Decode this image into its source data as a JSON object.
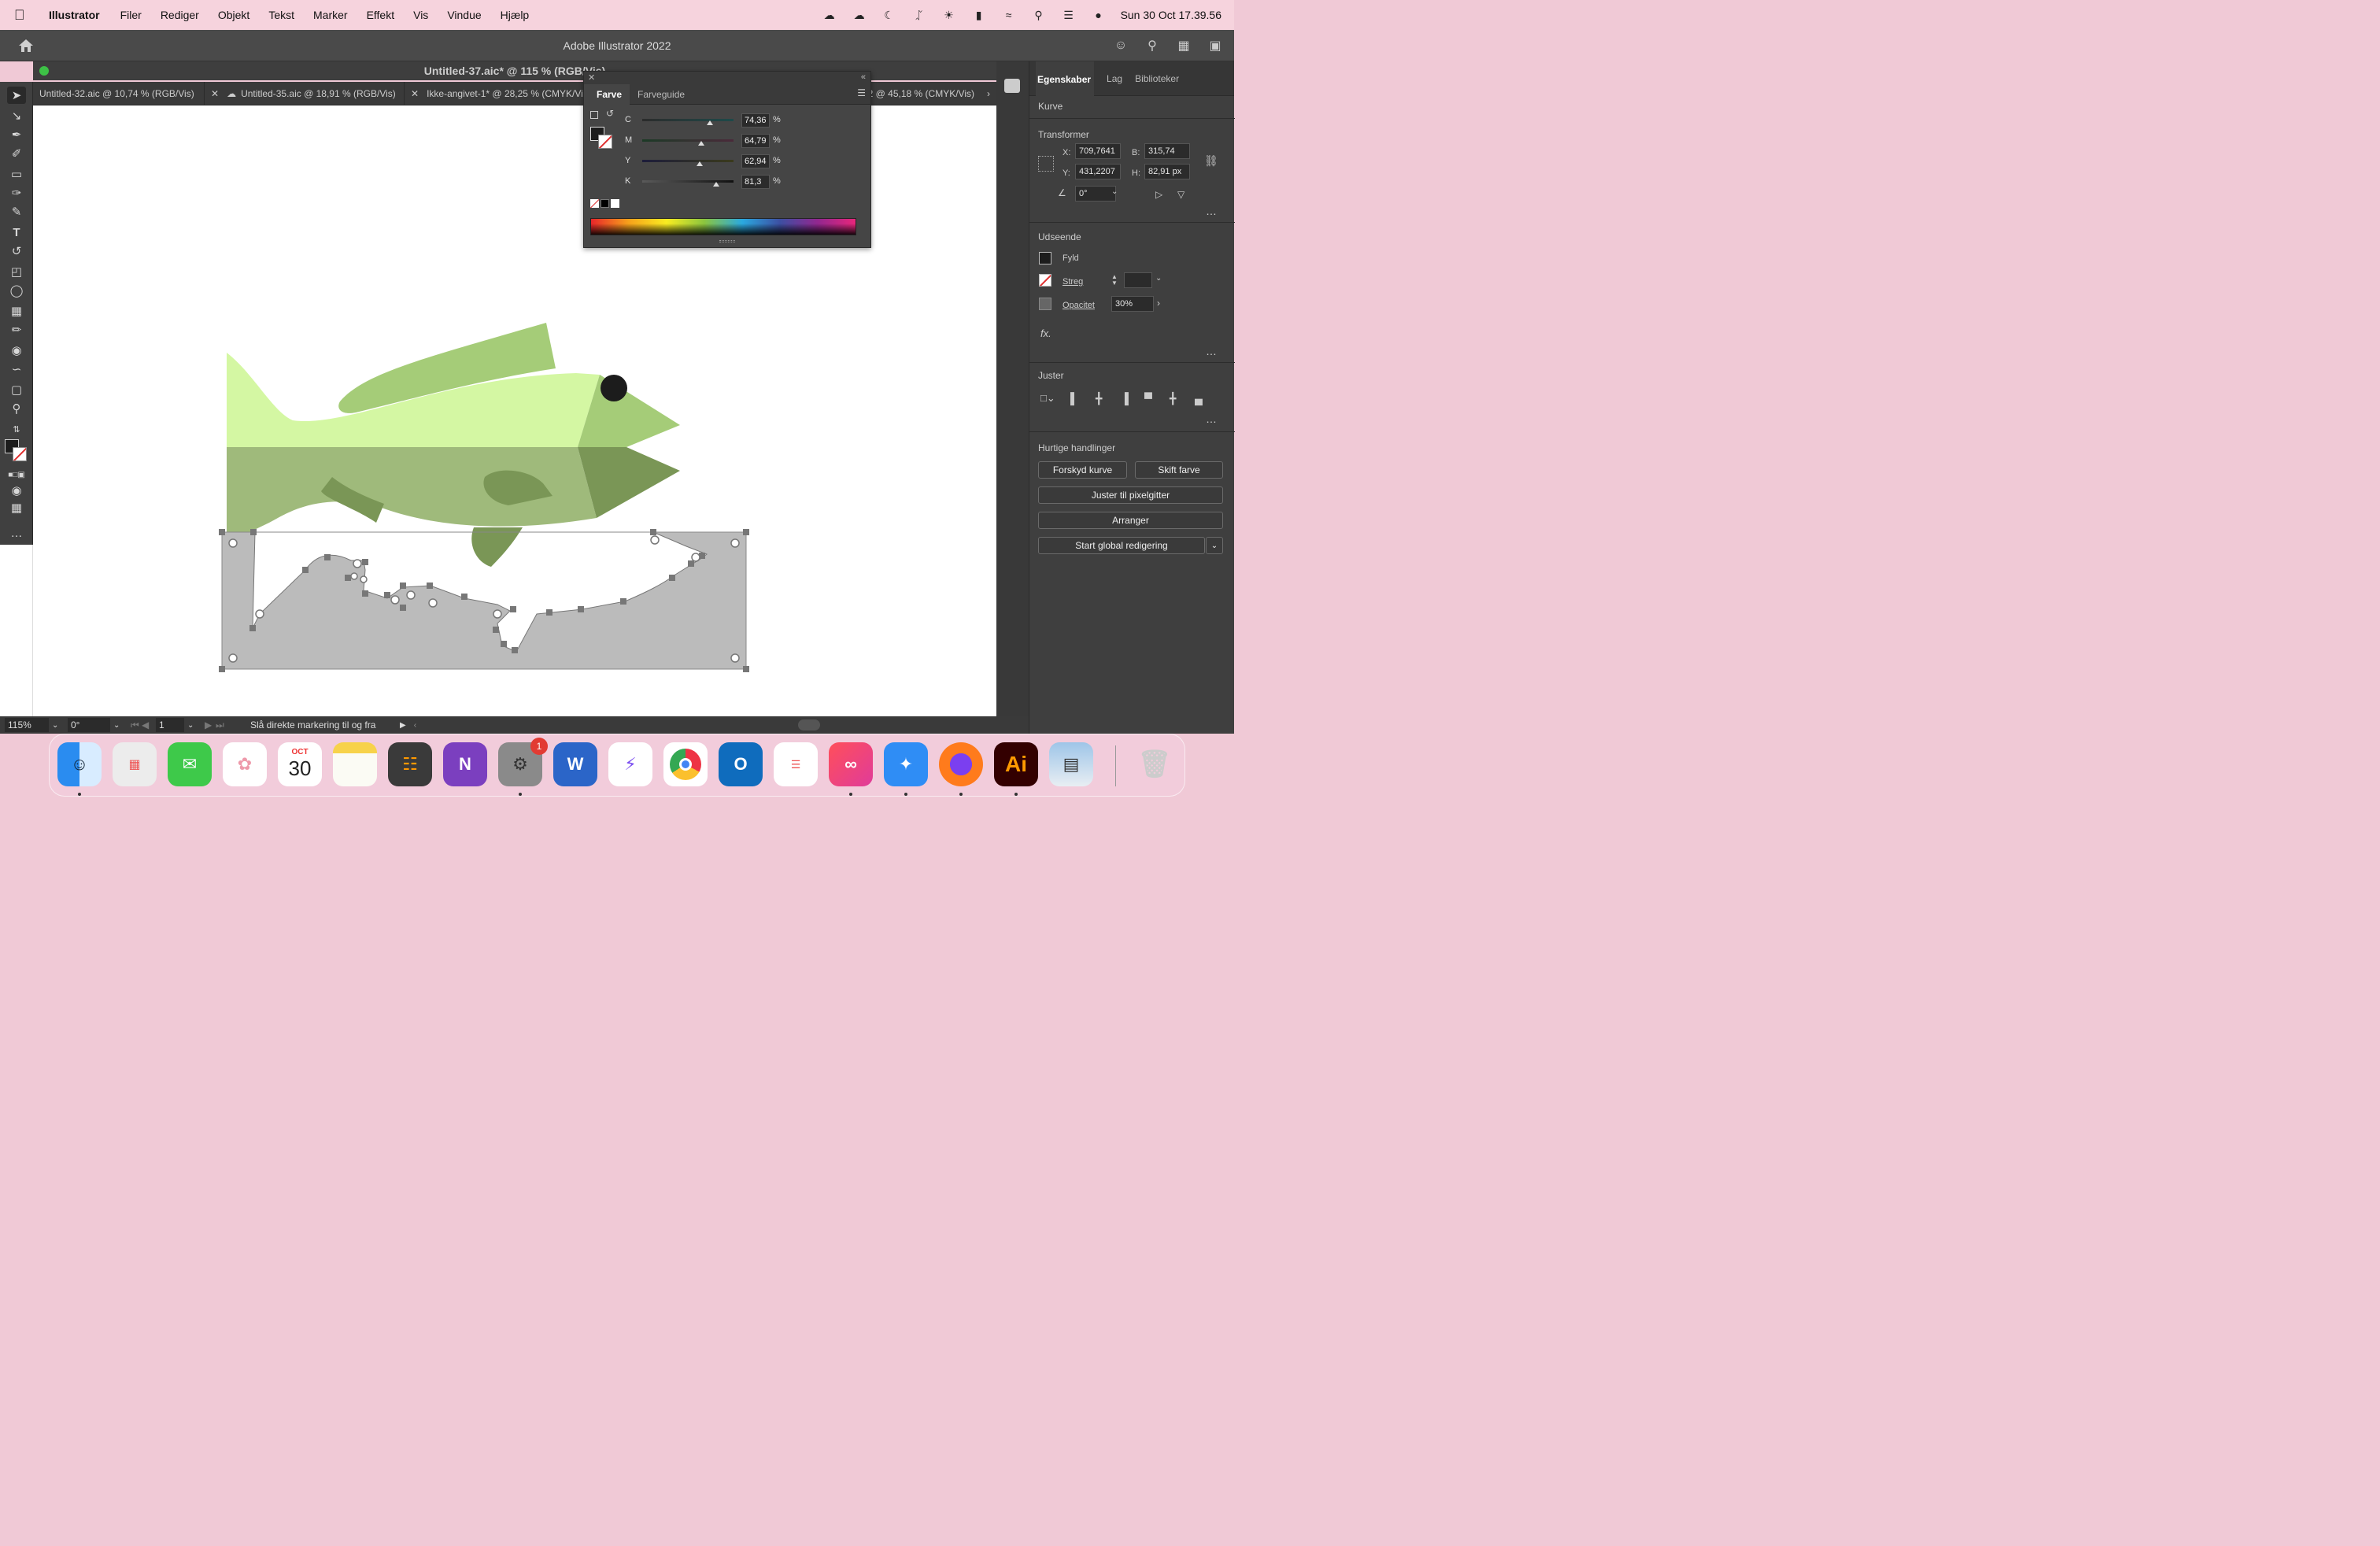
{
  "menubar": {
    "app_name": "Illustrator",
    "items": [
      "Filer",
      "Rediger",
      "Objekt",
      "Tekst",
      "Marker",
      "Effekt",
      "Vis",
      "Vindue",
      "Hjælp"
    ],
    "clock": "Sun 30 Oct  17.39.56"
  },
  "app_title": "Adobe Illustrator 2022",
  "doc_title": "Untitled-37.aic* @ 115 % (RGB/Vis)",
  "tabs": [
    {
      "label": "Untitled-32.aic @ 10,74 % (RGB/Vis)"
    },
    {
      "label": "Untitled-35.aic @ 18,91 % (RGB/Vis)"
    },
    {
      "label": "Ikke-angivet-1* @ 28,25 % (CMYK/Vis)"
    },
    {
      "label": "-2 @ 45,18 % (CMYK/Vis)"
    }
  ],
  "color_panel": {
    "tab_active": "Farve",
    "tab_other": "Farveguide",
    "sliders": [
      {
        "label": "C",
        "value": "74,36",
        "fraction": 0.7436,
        "color_from": "#2b2b2b",
        "color_to": "#1e4a4a"
      },
      {
        "label": "M",
        "value": "64,79",
        "fraction": 0.6479,
        "color_from": "#1c3a26",
        "color_to": "#4a2a3a"
      },
      {
        "label": "Y",
        "value": "62,94",
        "fraction": 0.6294,
        "color_from": "#1c1c3a",
        "color_to": "#3a3a1c"
      },
      {
        "label": "K",
        "value": "81,3",
        "fraction": 0.813,
        "color_from": "#5a5a5a",
        "color_to": "#111111"
      }
    ],
    "unit": "%"
  },
  "properties": {
    "tabs": [
      "Egenskaber",
      "Lag",
      "Biblioteker"
    ],
    "object_type": "Kurve",
    "transform": {
      "title": "Transformer",
      "x_label": "X:",
      "x_value": "709,7641",
      "y_label": "Y:",
      "y_value": "431,2207",
      "w_label": "B:",
      "w_value": "315,74 px",
      "h_label": "H:",
      "h_value": "82,91 px",
      "angle": "0°"
    },
    "appearance": {
      "title": "Udseende",
      "fill_label": "Fyld",
      "stroke_label": "Streg",
      "opacity_label": "Opacitet",
      "opacity_value": "30%",
      "fx": "fx."
    },
    "align": {
      "title": "Juster"
    },
    "quick": {
      "title": "Hurtige handlinger",
      "buttons": [
        "Forskyd kurve",
        "Skift farve",
        "Juster til pixelgitter",
        "Arranger",
        "Start global redigering"
      ]
    }
  },
  "statusbar": {
    "zoom": "115%",
    "rotate": "0°",
    "artboard": "1",
    "info": "Slå direkte markering til og fra"
  },
  "dock": {
    "calendar_month": "OCT",
    "calendar_day": "30",
    "badge_settings": "1",
    "onenote_letter": "N",
    "word_letter": "W",
    "ai_letter": "Ai",
    "outlook_letter": "O"
  },
  "colors": {
    "fish_light": "#d4f7a3",
    "fish_mid": "#a5cc78",
    "fish_dark_belly": "#9fba7b",
    "fish_darker": "#7a9656",
    "eye": "#1c1c1c",
    "selection_fill": "#bbbbbb",
    "ui_dark": "#3f3f3f"
  }
}
